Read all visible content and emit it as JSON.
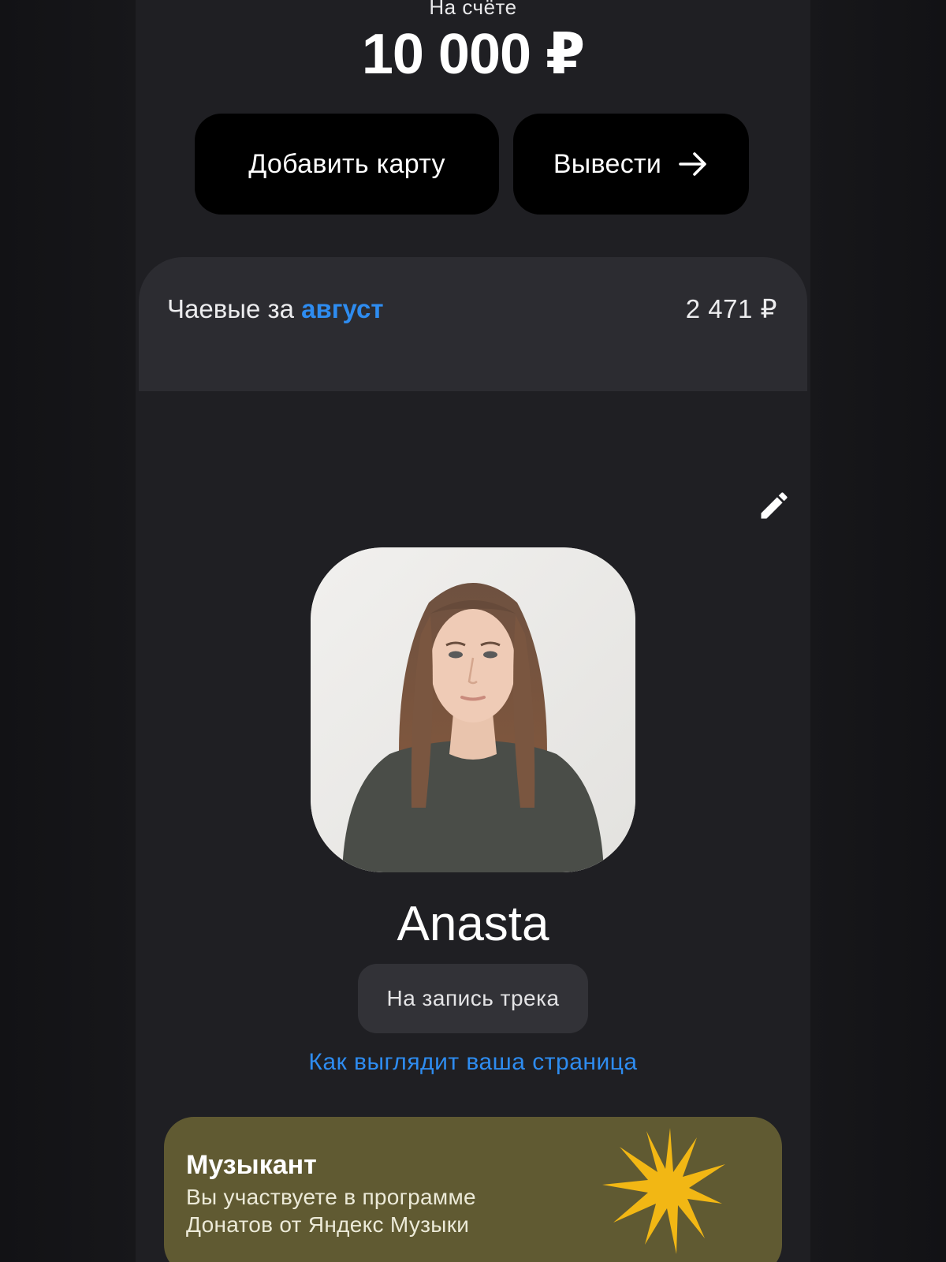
{
  "balance": {
    "label": "На счёте",
    "amount": "10 000 ₽"
  },
  "actions": {
    "add_card_label": "Добавить карту",
    "withdraw_label": "Вывести"
  },
  "tips": {
    "prefix": "Чаевые за",
    "month": "август",
    "amount": "2 471 ₽"
  },
  "profile": {
    "name": "Anasta",
    "tag": "На запись трека",
    "preview_link": "Как выглядит ваша страница"
  },
  "program": {
    "title": "Музыкант",
    "description": "Вы участвуете в программе Донатов от Яндекс Музыки"
  },
  "colors": {
    "accent_blue": "#2e8cf0",
    "banner_bg": "#605a32",
    "star_yellow": "#f2b714",
    "background": "#1f1f23"
  },
  "icons": {
    "edit": "pencil-icon",
    "withdraw": "arrow-right-icon",
    "program": "star-burst-icon"
  }
}
